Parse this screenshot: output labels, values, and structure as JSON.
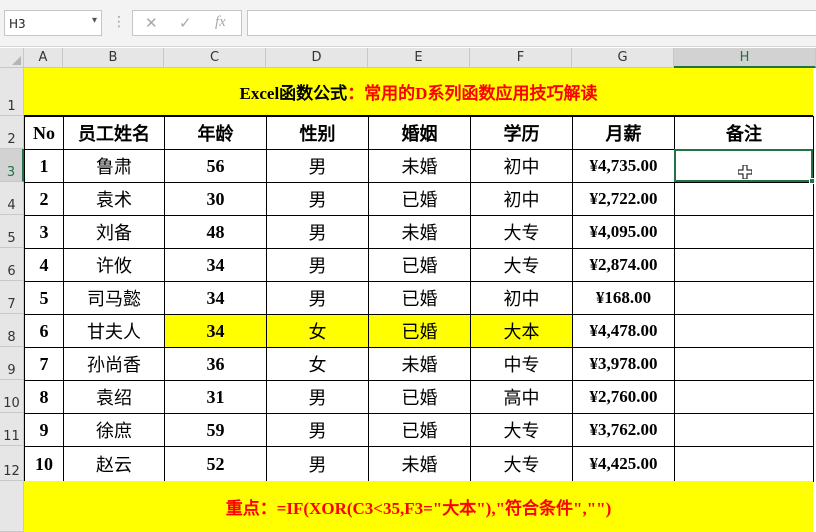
{
  "formula_bar": {
    "name_box": "H3",
    "name_box_dropdown": "▾",
    "separator": "⋮",
    "cancel_glyph": "✕",
    "enter_glyph": "✓",
    "fx_glyph": "fx",
    "formula": ""
  },
  "columns": [
    "A",
    "B",
    "C",
    "D",
    "E",
    "F",
    "G",
    "H"
  ],
  "rows": [
    "1",
    "2",
    "3",
    "4",
    "5",
    "6",
    "7",
    "8",
    "9",
    "10",
    "11",
    "12"
  ],
  "selected_cell": "H3",
  "sheet": {
    "title_part1": "Excel函数公式",
    "title_part2": "：常用的D系列函数应用技巧解读",
    "headers": [
      "No",
      "员工姓名",
      "年龄",
      "性别",
      "婚姻",
      "学历",
      "月薪",
      "备注"
    ],
    "records": [
      {
        "no": "1",
        "name": "鲁肃",
        "age": "56",
        "gender": "男",
        "marital": "未婚",
        "edu": "初中",
        "salary": "¥4,735.00",
        "note": ""
      },
      {
        "no": "2",
        "name": "袁术",
        "age": "30",
        "gender": "男",
        "marital": "已婚",
        "edu": "初中",
        "salary": "¥2,722.00",
        "note": ""
      },
      {
        "no": "3",
        "name": "刘备",
        "age": "48",
        "gender": "男",
        "marital": "未婚",
        "edu": "大专",
        "salary": "¥4,095.00",
        "note": ""
      },
      {
        "no": "4",
        "name": "许攸",
        "age": "34",
        "gender": "男",
        "marital": "已婚",
        "edu": "大专",
        "salary": "¥2,874.00",
        "note": ""
      },
      {
        "no": "5",
        "name": "司马懿",
        "age": "34",
        "gender": "男",
        "marital": "已婚",
        "edu": "初中",
        "salary": "¥168.00",
        "note": ""
      },
      {
        "no": "6",
        "name": "甘夫人",
        "age": "34",
        "gender": "女",
        "marital": "已婚",
        "edu": "大本",
        "salary": "¥4,478.00",
        "note": ""
      },
      {
        "no": "7",
        "name": "孙尚香",
        "age": "36",
        "gender": "女",
        "marital": "未婚",
        "edu": "中专",
        "salary": "¥3,978.00",
        "note": ""
      },
      {
        "no": "8",
        "name": "袁绍",
        "age": "31",
        "gender": "男",
        "marital": "已婚",
        "edu": "高中",
        "salary": "¥2,760.00",
        "note": ""
      },
      {
        "no": "9",
        "name": "徐庶",
        "age": "59",
        "gender": "男",
        "marital": "已婚",
        "edu": "大专",
        "salary": "¥3,762.00",
        "note": ""
      },
      {
        "no": "10",
        "name": "赵云",
        "age": "52",
        "gender": "男",
        "marital": "未婚",
        "edu": "大专",
        "salary": "¥4,425.00",
        "note": ""
      }
    ],
    "highlight_record_index": 5,
    "footer": "重点：=IF(XOR(C3<35,F3=\"大本\"),\"符合条件\",\"\")"
  },
  "colors": {
    "highlight": "#ffff00",
    "title_red": "#ff0000",
    "selection": "#217346"
  },
  "icons": {
    "cursor": "cell-cursor-icon"
  }
}
